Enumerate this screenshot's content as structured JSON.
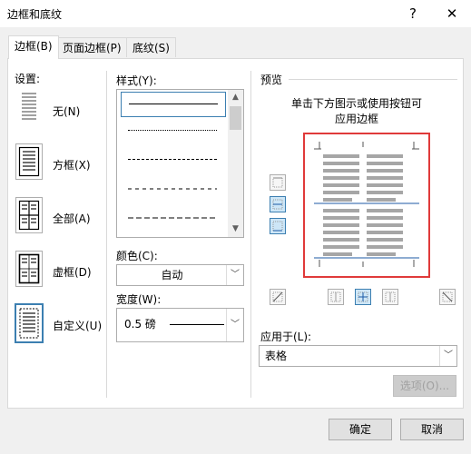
{
  "window": {
    "title": "边框和底纹",
    "help_label": "?",
    "close_label": "✕"
  },
  "tabs": [
    {
      "label": "边框(B)",
      "active": true
    },
    {
      "label": "页面边框(P)",
      "active": false
    },
    {
      "label": "底纹(S)",
      "active": false
    }
  ],
  "settings": {
    "label": "设置:",
    "items": [
      {
        "label": "无(N)",
        "icon": "setting-none-icon",
        "selected": false
      },
      {
        "label": "方框(X)",
        "icon": "setting-box-icon",
        "selected": false
      },
      {
        "label": "全部(A)",
        "icon": "setting-all-icon",
        "selected": false
      },
      {
        "label": "虚框(D)",
        "icon": "setting-grid-icon",
        "selected": false
      },
      {
        "label": "自定义(U)",
        "icon": "setting-custom-icon",
        "selected": true
      }
    ]
  },
  "style": {
    "label": "样式(Y):",
    "items": [
      "solid",
      "dotted",
      "dashed-fine",
      "dashed",
      "dashed-long"
    ],
    "selected_index": 0
  },
  "color": {
    "label": "颜色(C):",
    "value": "自动"
  },
  "width": {
    "label": "宽度(W):",
    "value": "0.5 磅"
  },
  "preview": {
    "label": "预览",
    "instruction_line1": "单击下方图示或使用按钮可",
    "instruction_line2": "应用边框",
    "highlight_color": "#e03a3a"
  },
  "apply_to": {
    "label": "应用于(L):",
    "value": "表格"
  },
  "buttons": {
    "options": "选项(O)...",
    "ok": "确定",
    "cancel": "取消"
  }
}
